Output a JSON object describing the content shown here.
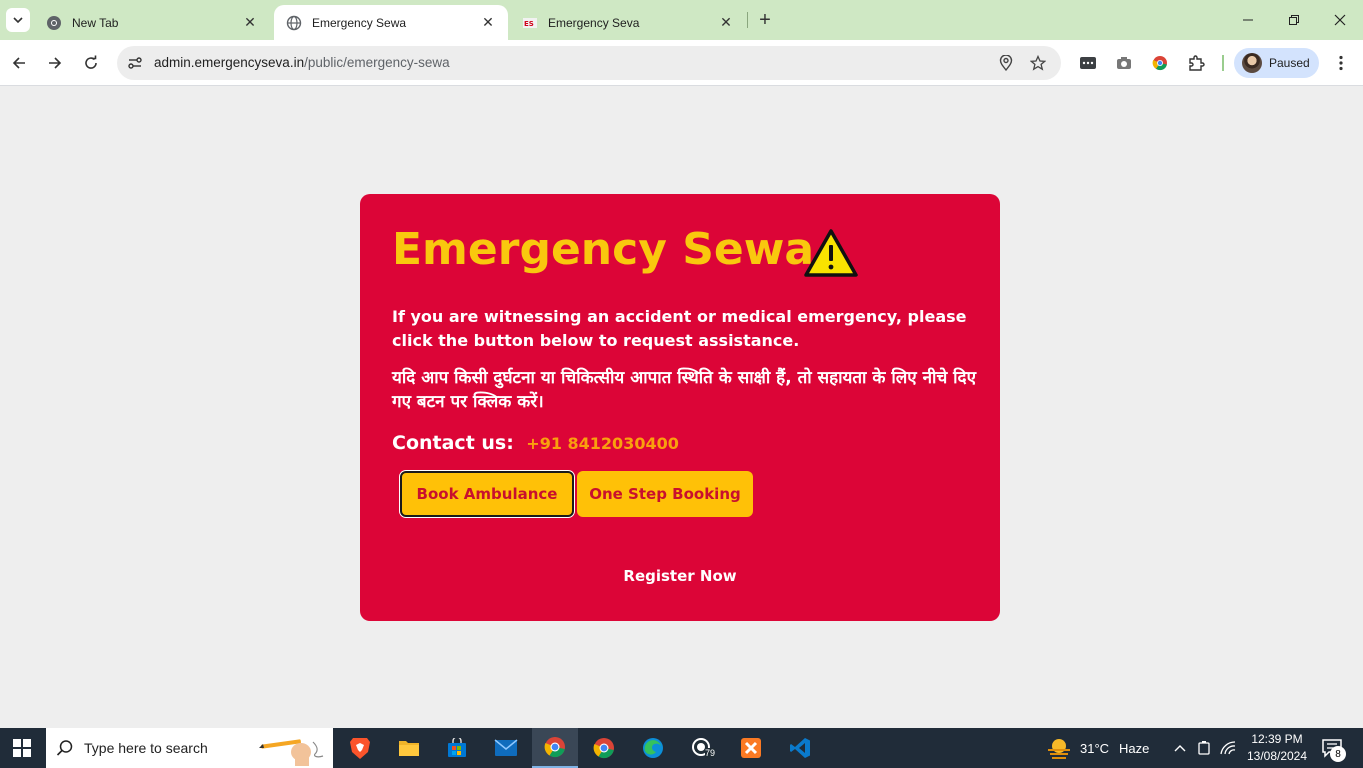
{
  "browser": {
    "tabs": [
      {
        "title": "New Tab",
        "favicon": "chrome-icon",
        "active": false
      },
      {
        "title": "Emergency Sewa",
        "favicon": "globe-icon",
        "active": true
      },
      {
        "title": "Emergency Seva",
        "favicon": "site-logo-icon",
        "active": false
      }
    ],
    "url_host": "admin.emergencyseva.in",
    "url_path": "/public/emergency-sewa",
    "profile_label": "Paused"
  },
  "page": {
    "title": "Emergency Sewa",
    "description_en": "If you are witnessing an accident or medical emergency, please click the button below to request assistance.",
    "description_hi": "यदि आप किसी दुर्घटना या चिकित्सीय आपात स्थिति के साक्षी हैं, तो सहायता के लिए नीचे दिए गए बटन पर क्लिक करें।",
    "contact_label": "Contact us:",
    "contact_phone": "+91 8412030400",
    "book_ambulance_label": "Book Ambulance",
    "one_step_booking_label": "One Step Booking",
    "register_label": "Register Now",
    "colors": {
      "card_bg": "#dc0537",
      "title": "#f9c80e",
      "button_bg": "#ffc107",
      "button_text": "#c8102e",
      "phone": "#f9a00e"
    }
  },
  "taskbar": {
    "search_placeholder": "Type here to search",
    "weather_temp": "31°C",
    "weather_condition": "Haze",
    "time": "12:39 PM",
    "date": "13/08/2024",
    "whatsapp_badge": "79",
    "notification_count": "8"
  }
}
